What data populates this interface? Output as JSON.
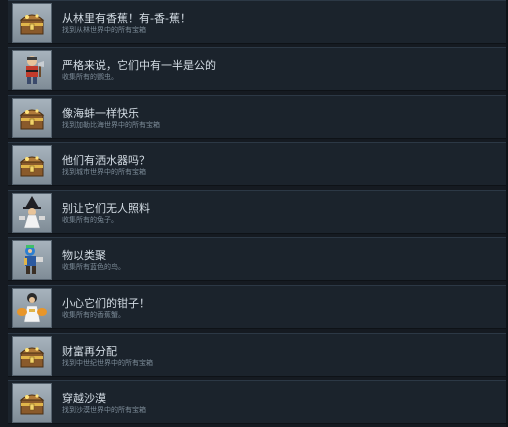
{
  "achievements": [
    {
      "title": "从林里有香蕉！有-香-蕉！",
      "description": "找到从林世界中的所有宝箱",
      "icon": "treasure-chest-icon"
    },
    {
      "title": "严格来说，它们中有一半是公的",
      "description": "收集所有的鹦虫。",
      "icon": "lumberjack-icon"
    },
    {
      "title": "像海蚌一样快乐",
      "description": "找到加勒比海世界中的所有宝箱",
      "icon": "treasure-chest-icon"
    },
    {
      "title": "他们有洒水器吗？",
      "description": "找到城市世界中的所有宝箱",
      "icon": "treasure-chest-icon"
    },
    {
      "title": "别让它们无人照料",
      "description": "收集所有的兔子。",
      "icon": "witch-figure-icon"
    },
    {
      "title": "物以类聚",
      "description": "收集所有蓝色的鸟。",
      "icon": "blue-bird-icon"
    },
    {
      "title": "小心它们的钳子！",
      "description": "收集所有的香蕉蟹。",
      "icon": "crab-figure-icon"
    },
    {
      "title": "财富再分配",
      "description": "找到中世纪世界中的所有宝箱",
      "icon": "treasure-chest-icon"
    },
    {
      "title": "穿越沙漠",
      "description": "找到沙漠世界中的所有宝箱",
      "icon": "treasure-chest-icon"
    }
  ]
}
